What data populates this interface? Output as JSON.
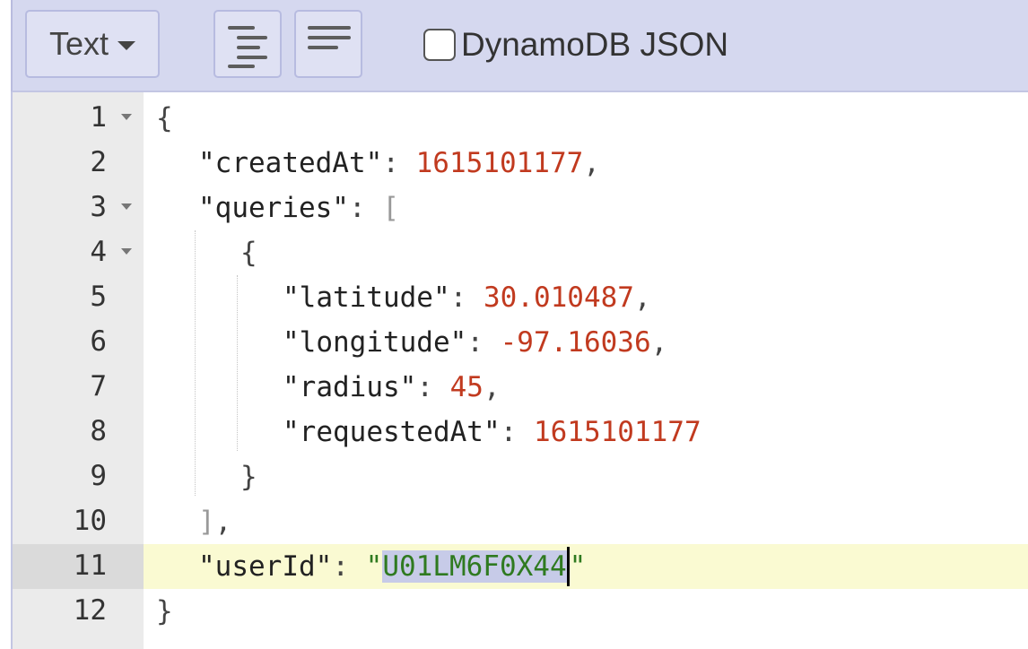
{
  "toolbar": {
    "mode_label": "Text",
    "format_icon": "format-indent-icon",
    "compact_icon": "compact-icon",
    "dynamodb_checkbox": {
      "label": "DynamoDB JSON",
      "checked": false
    }
  },
  "editor": {
    "active_line": 11,
    "gutter": [
      {
        "num": "1",
        "fold": true
      },
      {
        "num": "2",
        "fold": false
      },
      {
        "num": "3",
        "fold": true
      },
      {
        "num": "4",
        "fold": true
      },
      {
        "num": "5",
        "fold": false
      },
      {
        "num": "6",
        "fold": false
      },
      {
        "num": "7",
        "fold": false
      },
      {
        "num": "8",
        "fold": false
      },
      {
        "num": "9",
        "fold": false
      },
      {
        "num": "10",
        "fold": false
      },
      {
        "num": "11",
        "fold": false
      },
      {
        "num": "12",
        "fold": false
      }
    ],
    "code": {
      "l1_brace": "{",
      "l2_key": "\"createdAt\"",
      "l2_colon": ": ",
      "l2_value": "1615101177",
      "l2_comma": ",",
      "l3_key": "\"queries\"",
      "l3_colon": ": ",
      "l3_bracket": "[",
      "l4_brace": "{",
      "l5_key": "\"latitude\"",
      "l5_colon": ": ",
      "l5_value": "30.010487",
      "l5_comma": ",",
      "l6_key": "\"longitude\"",
      "l6_colon": ": ",
      "l6_value": "-97.16036",
      "l6_comma": ",",
      "l7_key": "\"radius\"",
      "l7_colon": ": ",
      "l7_value": "45",
      "l7_comma": ",",
      "l8_key": "\"requestedAt\"",
      "l8_colon": ": ",
      "l8_value": "1615101177",
      "l9_brace": "}",
      "l10_bracket": "]",
      "l10_comma": ",",
      "l11_key": "\"userId\"",
      "l11_colon": ": ",
      "l11_quote_open": "\"",
      "l11_value": "U01LM6F0X44",
      "l11_quote_close": "\"",
      "l12_brace": "}"
    }
  }
}
